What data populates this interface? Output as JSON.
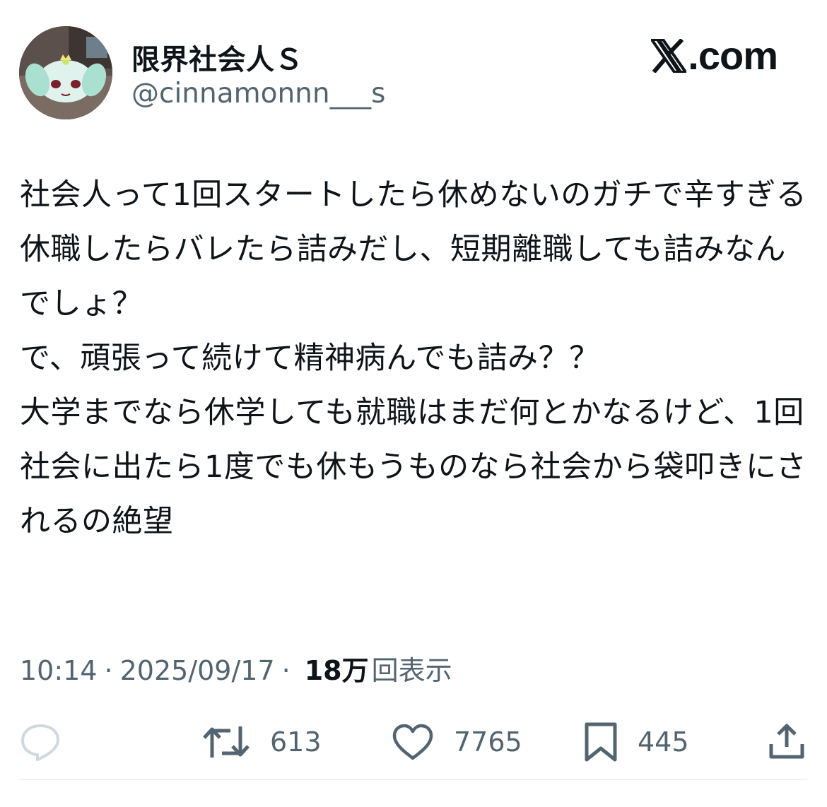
{
  "user": {
    "display_name": "限界社会人Ｓ",
    "handle": "@cinnamonnn___s"
  },
  "brand": {
    "text": ".com",
    "icon": "x-logo-icon"
  },
  "tweet": {
    "text": "社会人って1回スタートしたら休めないのガチで辛すぎる\n休職したらバレたら詰みだし、短期離職しても詰みなんでしょ？\nで、頑張って続けて精神病んでも詰み？？\n大学までなら休学しても就職はまだ何とかなるけど、1回社会に出たら1度でも休もうものなら社会から袋叩きにされるの絶望",
    "time": "10:14",
    "date": "2025/09/17",
    "separator": "·",
    "views_count": "18万",
    "views_label": "回表示"
  },
  "actions": {
    "reply": {
      "icon": "reply-icon"
    },
    "retweet": {
      "icon": "retweet-icon",
      "count": "613"
    },
    "like": {
      "icon": "heart-icon",
      "count": "7765"
    },
    "bookmark": {
      "icon": "bookmark-icon",
      "count": "445"
    },
    "share": {
      "icon": "share-icon"
    }
  },
  "colors": {
    "text": "#0f1419",
    "secondary": "#536471",
    "divider": "#eff3f4",
    "reply_icon": "#cfd9de"
  }
}
